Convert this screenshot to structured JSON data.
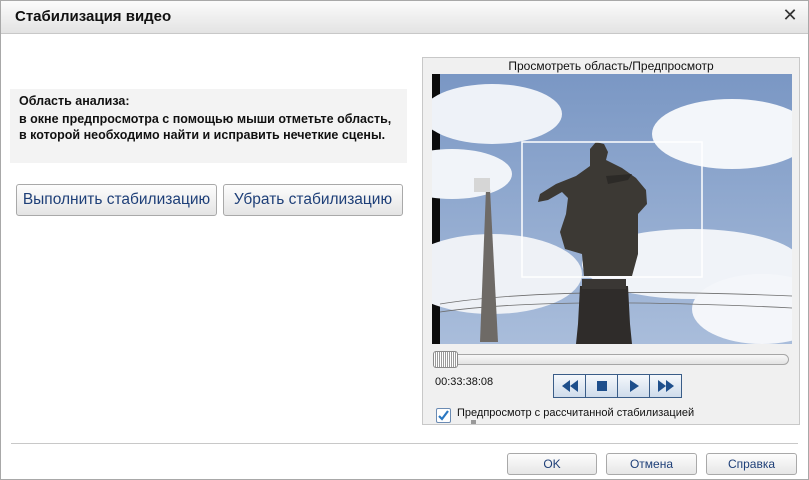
{
  "window": {
    "title": "Стабилизация видео",
    "close_glyph": "✕"
  },
  "analysis": {
    "title": "Область анализа:",
    "description": "в окне предпросмотра с помощью мыши отметьте область, в которой необходимо найти и исправить нечеткие сцены."
  },
  "actions": {
    "stabilize_label": "Выполнить стабилизацию",
    "remove_label": "Убрать стабилизацию"
  },
  "preview": {
    "label": "Просмотреть область/Предпросмотр",
    "timecode": "00:33:38:08",
    "position_fraction": 0.0,
    "checkbox_checked": true,
    "checkbox_label": "Предпросмотр с рассчитанной стабилизацией"
  },
  "transport": {
    "icons": [
      "rewind-icon",
      "stop-icon",
      "play-icon",
      "fast-forward-icon"
    ],
    "accent_color": "#1e4f8c"
  },
  "footer": {
    "ok_label": "OK",
    "cancel_label": "Отмена",
    "help_label": "Справка"
  }
}
